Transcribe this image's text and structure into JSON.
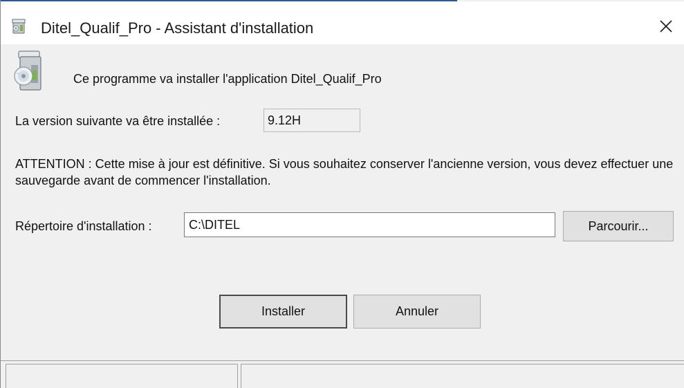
{
  "window": {
    "title": "Ditel_Qualif_Pro - Assistant d'installation",
    "title_icon": "installer-icon",
    "close_icon": "close-icon"
  },
  "main": {
    "app_icon": "installer-disc-icon",
    "intro_text": "Ce programme va installer l'application Ditel_Qualif_Pro",
    "version_label": "La version suivante va être installée :",
    "version_value": "9.12H",
    "warning_text": "ATTENTION : Cette mise à jour est définitive. Si vous souhaitez conserver l'ancienne version, vous devez effectuer une sauvegarde avant de commencer l'installation.",
    "dir_label": "Répertoire d'installation :",
    "dir_value": "C:\\DITEL",
    "browse_label": "Parcourir...",
    "install_label": "Installer",
    "cancel_label": "Annuler"
  },
  "colors": {
    "window_bg": "#f0f0f0",
    "titlebar_bg": "#ffffff",
    "button_bg": "#e1e1e1",
    "accent_line": "#2b5797"
  }
}
